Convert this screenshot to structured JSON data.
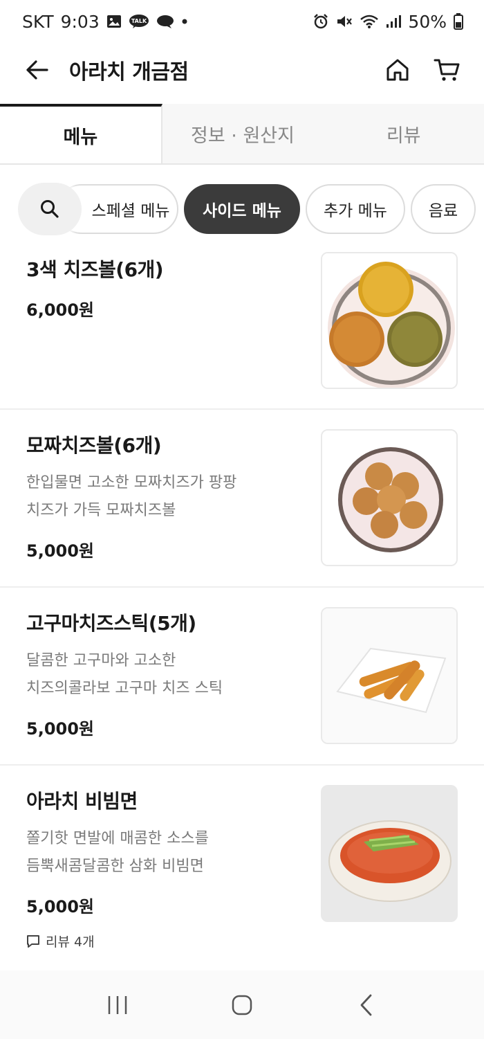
{
  "status_bar": {
    "carrier": "SKT",
    "time": "9:03",
    "battery": "50%",
    "icons": [
      "image-icon",
      "kakaotalk-icon",
      "chat-icon",
      "dot-icon",
      "alarm-icon",
      "mute-icon",
      "wifi-icon",
      "signal-icon",
      "battery-icon"
    ],
    "talk_label": "TALK"
  },
  "header": {
    "title": "아라치 개금점",
    "icons": [
      "back-arrow-icon",
      "home-icon",
      "cart-icon"
    ]
  },
  "tabs": [
    {
      "label": "메뉴",
      "active": true
    },
    {
      "label": "정보 · 원산지",
      "active": false
    },
    {
      "label": "리뷰",
      "active": false
    }
  ],
  "categories": [
    {
      "label": "스페셜 메뉴",
      "active": false
    },
    {
      "label": "사이드 메뉴",
      "active": true
    },
    {
      "label": "추가 메뉴",
      "active": false
    },
    {
      "label": "음료",
      "active": false
    }
  ],
  "menu_items": [
    {
      "name": "3색 치즈볼(6개)",
      "desc1": "",
      "desc2": "",
      "price": "6,000원",
      "image": "three-color-cheese-balls-photo"
    },
    {
      "name": "모짜치즈볼(6개)",
      "desc1": "한입물면 고소한 모짜치즈가 팡팡",
      "desc2": "치즈가 가득 모짜치즈볼",
      "price": "5,000원",
      "image": "mozza-cheese-balls-photo"
    },
    {
      "name": "고구마치즈스틱(5개)",
      "desc1": "달콤한 고구마와 고소한",
      "desc2": "치즈의콜라보 고구마 치즈 스틱",
      "price": "5,000원",
      "image": "sweet-potato-cheese-sticks-photo"
    },
    {
      "name": "아라치 비빔면",
      "desc1": "쫄기핫 면발에 매콤한 소스를",
      "desc2": "듬뿍새콤달콤한 삼화 비빔면",
      "price": "5,000원",
      "image": "bibim-noodles-photo",
      "review": "리뷰 4개"
    }
  ],
  "nav_bar": {
    "icons": [
      "recent-apps-icon",
      "home-circle-icon",
      "back-chevron-icon"
    ]
  },
  "colors": {
    "accent_dark": "#3b3b3b",
    "text_primary": "#1a1a1a",
    "text_secondary": "#7a7a7a",
    "divider": "#eeeeee"
  }
}
